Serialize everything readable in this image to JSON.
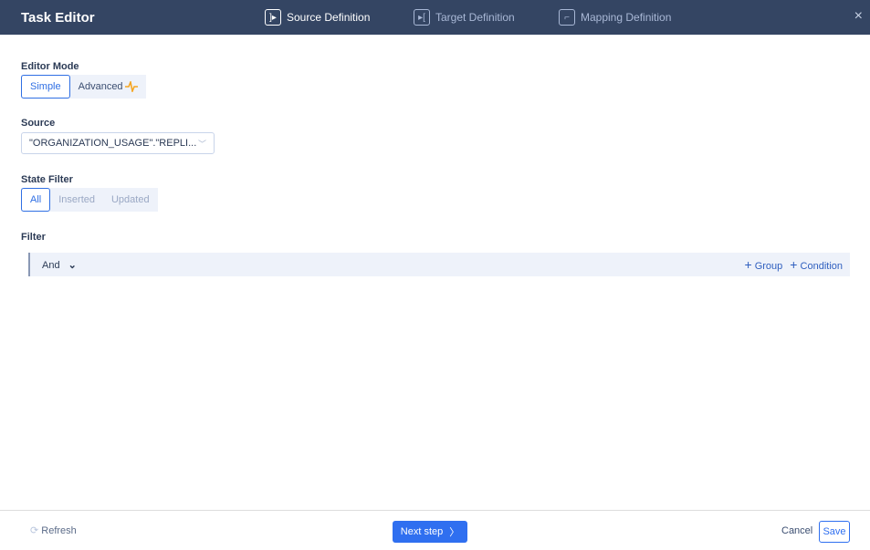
{
  "header": {
    "title": "Task Editor",
    "tabs": [
      {
        "label": "Source Definition",
        "icon": "source-icon",
        "active": true
      },
      {
        "label": "Target Definition",
        "icon": "target-icon",
        "active": false
      },
      {
        "label": "Mapping Definition",
        "icon": "mapping-icon",
        "active": false
      }
    ],
    "close": "×"
  },
  "editor_mode": {
    "label": "Editor Mode",
    "options": [
      "Simple",
      "Advanced"
    ],
    "selected": "Simple"
  },
  "source": {
    "label": "Source",
    "value": "\"ORGANIZATION_USAGE\".\"REPLI..."
  },
  "state_filter": {
    "label": "State Filter",
    "options": [
      "All",
      "Inserted",
      "Updated"
    ],
    "selected": "All"
  },
  "filter": {
    "label": "Filter",
    "operator": "And",
    "add_group": "Group",
    "add_condition": "Condition"
  },
  "footer": {
    "refresh": "Refresh",
    "next": "Next step",
    "cancel": "Cancel",
    "save": "Save"
  },
  "colors": {
    "header": "#344563",
    "accent": "#2f6ff0",
    "advanced_icon": "#f5a623"
  }
}
